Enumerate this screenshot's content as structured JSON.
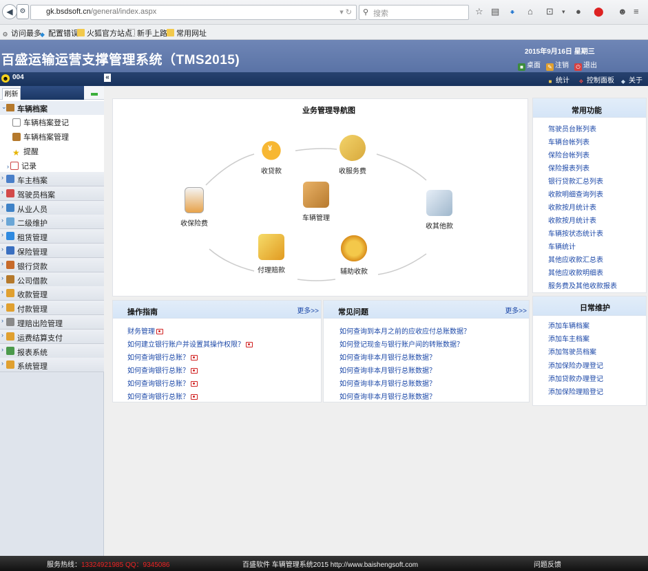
{
  "browser": {
    "url_domain": "gk.bsdsoft.cn",
    "url_path": "/general/index.aspx",
    "search_placeholder": "搜索",
    "bookmarks": [
      "访问最多",
      "配置错误",
      "火狐官方站点",
      "新手上路",
      "常用网址"
    ]
  },
  "header": {
    "title": "百盛运输运营支撑管理系统（TMS2015)",
    "date": "2015年9月16日 星期三",
    "links": [
      "桌面",
      "注销",
      "退出"
    ]
  },
  "menubar": {
    "user": "004",
    "links": [
      "统计",
      "控制面板",
      "关于"
    ]
  },
  "sidebar": {
    "refresh_tab": "刷新",
    "open_group": "车辆档案",
    "sub_items": [
      "车辆档案登记",
      "车辆档案管理",
      "提醒",
      "记录"
    ],
    "groups": [
      "车主档案",
      "驾驶员档案",
      "从业人员",
      "二级维护",
      "租赁管理",
      "保险管理",
      "银行贷款",
      "公司借款",
      "收款管理",
      "付款管理",
      "理赔出险管理",
      "运费结算支付",
      "报表系统",
      "系统管理"
    ]
  },
  "nav_diagram": {
    "title": "业务管理导航图",
    "nodes": {
      "loan": "收贷款",
      "service": "收服务费",
      "insurance": "收保险费",
      "vehicle": "车辆管理",
      "other": "收其他款",
      "claim": "付理赔款",
      "aux": "辅助收款"
    }
  },
  "guide": {
    "title": "操作指南",
    "more": "更多>>",
    "items": [
      "财务管理",
      "如何建立银行账户并设置其操作权限？",
      "如何查询银行总账？",
      "如何查询银行总账？",
      "如何查询银行总账？",
      "如何查询银行总账？"
    ]
  },
  "faq": {
    "title": "常见问题",
    "more": "更多>>",
    "items": [
      "如何查询到本月之前的应收应付总账数据？",
      "如何登记现金与银行账户间的转账数据？",
      "如何查询非本月银行总账数据？",
      "如何查询非本月银行总账数据？",
      "如何查询非本月银行总账数据？",
      "如何查询非本月银行总账数据？"
    ]
  },
  "common": {
    "title": "常用功能",
    "items": [
      "驾驶员台账列表",
      "车辆台帐列表",
      "保险台帐列表",
      "保险报表列表",
      "银行贷款汇总列表",
      "收款明细查询列表",
      "收款按月统计表",
      "收款按月统计表",
      "车辆按状态统计表",
      "车辆统计",
      "其他应收款汇总表",
      "其他应收款明细表",
      "服务费及其他收款报表"
    ]
  },
  "maintenance": {
    "title": "日常维护",
    "items": [
      "添加车辆档案",
      "添加车主档案",
      "添加驾驶员档案",
      "添加保险办理登记",
      "添加贷款办理登记",
      "添加保险理赔登记"
    ]
  },
  "footer": {
    "hotline_label": "服务热线：",
    "hotline_value": "13324921985  QQ：9345086",
    "center": "百盛软件 车辆管理系统2015 http://www.baishengsoft.com",
    "feedback": "问题反馈"
  }
}
